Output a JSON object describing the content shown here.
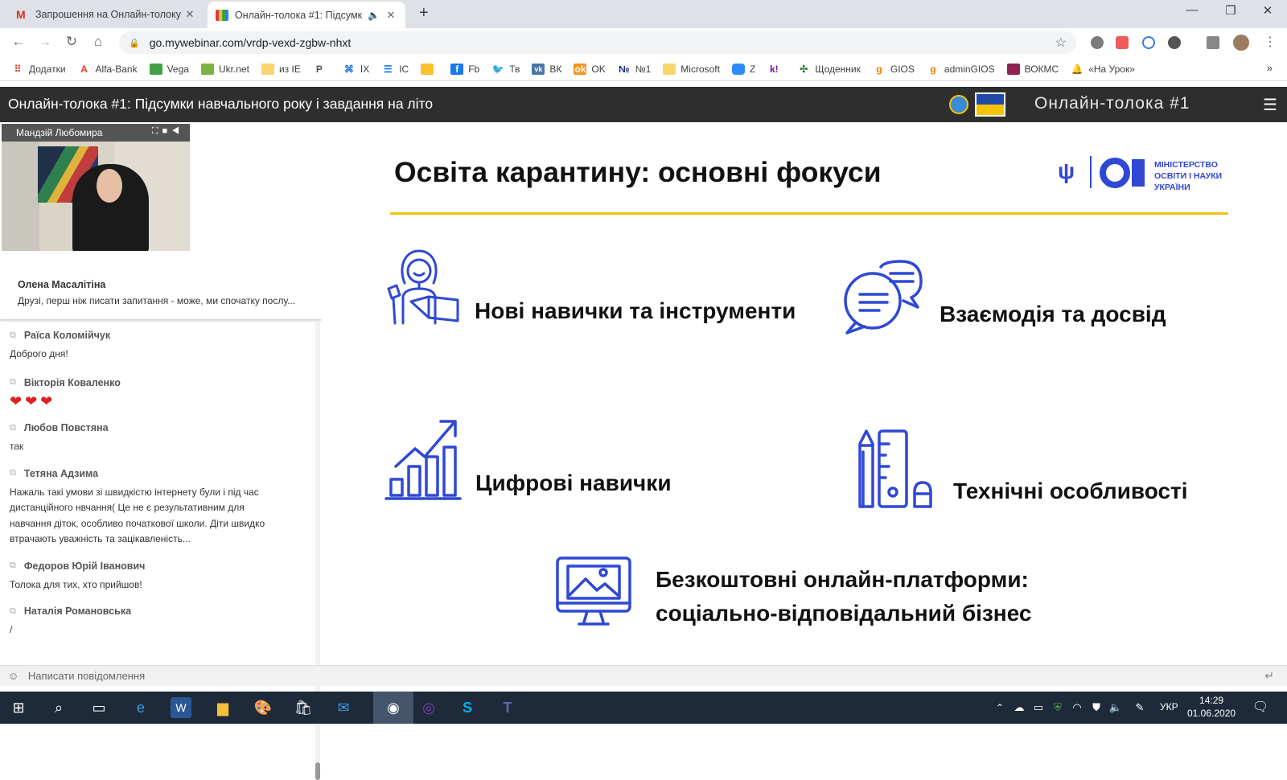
{
  "browser": {
    "tabs": [
      {
        "title": "Запрошення на Онлайн-толоку",
        "active": false
      },
      {
        "title": "Онлайн-толока #1: Підсумк",
        "active": true
      }
    ],
    "url": "go.mywebinar.com/vrdp-vexd-zgbw-nhxt",
    "bookmarks": [
      "Додатки",
      "Alfa-Bank",
      "Vega",
      "Ukr.net",
      "из IE",
      "",
      "IX",
      "IC",
      "",
      "Fb",
      "Тв",
      "ВК",
      "OK",
      "№1",
      "Microsoft",
      "Z",
      "",
      "Щоденник",
      "GIOS",
      "adminGIOS",
      "ВОКМС",
      "«На Урок»"
    ],
    "more": "»"
  },
  "app": {
    "title": "Онлайн-толока #1: Підсумки навчального року і завдання на літо",
    "brand": "Онлайн-толока #1",
    "hamburger": "☰"
  },
  "video": {
    "speaker": "Мандзій Любомира"
  },
  "chat": {
    "pinned": {
      "name": "Олена Масалітіна",
      "text": "Друзі, перш ніж писати запитання - може, ми спочатку послу..."
    },
    "messages": [
      {
        "name": "Раїса Коломійчук",
        "text": "Доброго дня!"
      },
      {
        "name": "Вікторія Коваленко",
        "text": "❤❤❤"
      },
      {
        "name": "Любов Повстяна",
        "text": "так"
      },
      {
        "name": "Тетяна Адзима",
        "text": "Нажаль такі умови зі швидкістю інтернету були і під час дистанційного нвчання( Це не є результативним для навчання діток, особливо початкової школи. Діти швидко втрачають уважність та зацікавленість..."
      },
      {
        "name": "Федоров Юрій Іванович",
        "text": "Толока для тих, хто прийшов!"
      },
      {
        "name": "Наталія Романовська",
        "text": "/"
      }
    ],
    "input_placeholder": "Написати повідомлення"
  },
  "slide": {
    "title": "Освіта карантину: основні фокуси",
    "ministry": [
      "МІНІСТЕРСТВО",
      "ОСВІТИ І НАУКИ",
      "УКРАЇНИ"
    ],
    "items": [
      "Нові навички та інструменти",
      "Взаємодія та досвід",
      "Цифрові навички",
      "Технічні особливості",
      "Безкоштовні онлайн-платформи:",
      "соціально-відповідальний бізнес"
    ],
    "colors": {
      "icon": "#2f48d5",
      "accent": "#f2c20f"
    }
  },
  "taskbar": {
    "lang": "УКР",
    "time": "14:29",
    "date": "01.06.2020"
  }
}
